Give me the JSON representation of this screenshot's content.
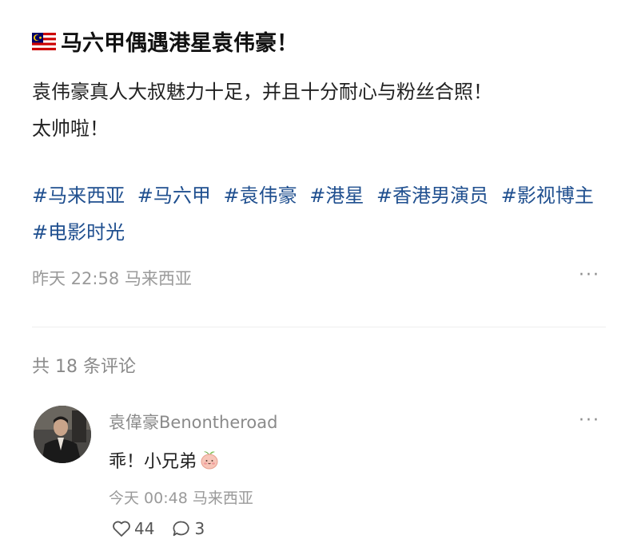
{
  "post": {
    "flag_icon": "malaysia-flag-icon",
    "title": "马六甲偶遇港星袁伟豪！",
    "body_line1": "袁伟豪真人大叔魅力十足，并且十分耐心与粉丝合照！",
    "body_line2": "太帅啦！",
    "tags": [
      "#马来西亚",
      "#马六甲",
      "#袁伟豪",
      "#港星",
      "#香港男演员",
      "#影视博主",
      "#电影时光"
    ],
    "meta": "昨天 22:58 马来西亚",
    "more_label": "···"
  },
  "comments_section": {
    "count_label": "共 18 条评论"
  },
  "comment": {
    "username": "袁偉豪Benontheroad",
    "text": "乖！小兄弟",
    "emoji_icon": "peach-face-emoji-icon",
    "meta": "今天 00:48 马来西亚",
    "likes": "44",
    "replies": "3",
    "more_label": "···"
  },
  "colors": {
    "tag_blue": "#1f4f8f",
    "meta_gray": "#9a9a9a",
    "divider": "#eeeeee"
  }
}
